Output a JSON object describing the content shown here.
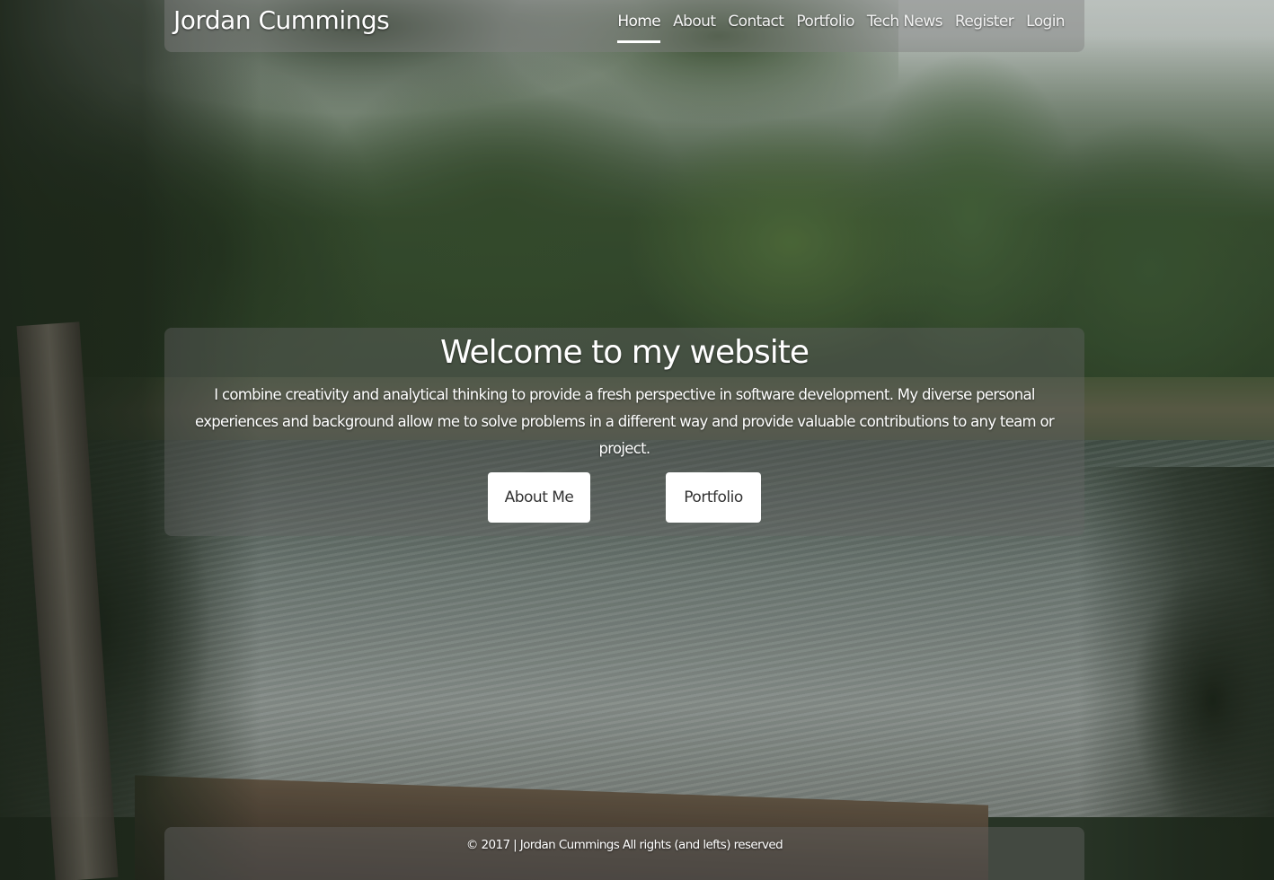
{
  "navbar": {
    "brand": "Jordan Cummings",
    "items": [
      {
        "label": "Home",
        "active": true
      },
      {
        "label": "About",
        "active": false
      },
      {
        "label": "Contact",
        "active": false
      },
      {
        "label": "Portfolio",
        "active": false
      },
      {
        "label": "Tech News",
        "active": false
      },
      {
        "label": "Register",
        "active": false
      },
      {
        "label": "Login",
        "active": false
      }
    ]
  },
  "hero": {
    "title": "Welcome to my website",
    "text": "I combine creativity and analytical thinking to provide a fresh perspective in software development. My diverse personal experiences and background allow me to solve problems in a different way and provide valuable contributions to any team or project.",
    "buttons": {
      "about": "About Me",
      "portfolio": "Portfolio"
    }
  },
  "footer": {
    "text": "© 2017 | Jordan Cummings All rights (and lefts) reserved"
  },
  "background": {
    "image": "forest-lake-photo"
  },
  "colors": {
    "panel": "#646464",
    "text": "#ffffff",
    "button_bg": "#ffffff",
    "button_text": "#333333"
  }
}
